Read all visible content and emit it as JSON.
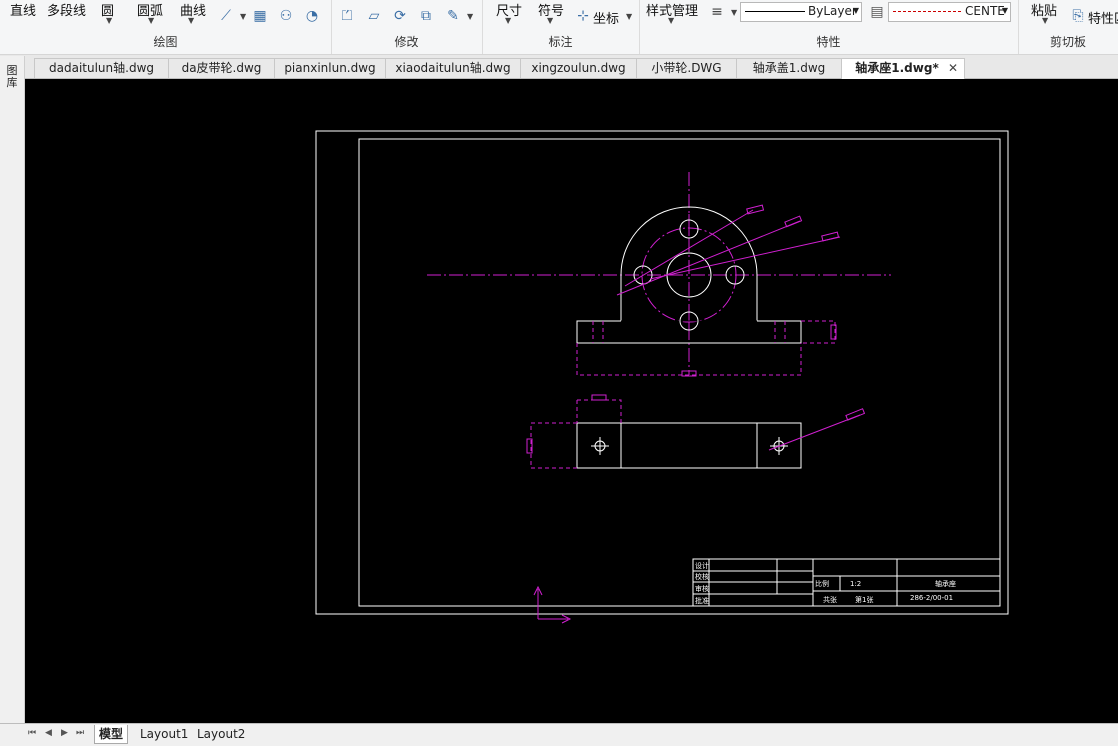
{
  "ribbon": {
    "draw_group": {
      "title": "绘图",
      "line": "直线",
      "polyline": "多段线",
      "circle": "圆",
      "arc": "圆弧",
      "curve": "曲线"
    },
    "modify_group": {
      "title": "修改"
    },
    "annotate_group": {
      "title": "标注",
      "dimension": "尺寸",
      "symbol": "符号",
      "coordinate": "坐标"
    },
    "properties_group": {
      "title": "特性",
      "style_manager": "样式管理",
      "linetype_value": "ByLayer",
      "centerline_value": "CENTE"
    },
    "clipboard_group": {
      "title": "剪切板",
      "paste": "粘贴",
      "properties_short": "特性匹"
    }
  },
  "tabs": [
    {
      "label": "dadaitulun轴.dwg"
    },
    {
      "label": "da皮带轮.dwg"
    },
    {
      "label": "pianxinlun.dwg"
    },
    {
      "label": "xiaodaitulun轴.dwg"
    },
    {
      "label": "xingzoulun.dwg"
    },
    {
      "label": "小带轮.DWG"
    },
    {
      "label": "轴承盖1.dwg"
    },
    {
      "label": "轴承座1.dwg*",
      "active": true
    }
  ],
  "left_strip_label": "图库",
  "layout_tabs": [
    {
      "label": "模型",
      "active": true
    },
    {
      "label": "Layout1"
    },
    {
      "label": "Layout2"
    }
  ],
  "title_block": {
    "rows": [
      "设计",
      "校核",
      "审核",
      "批准"
    ],
    "scale_label": "比例",
    "scale_value": "1:2",
    "part_name": "轴承座",
    "qty_label": "共张",
    "sheet_label": "第1张",
    "drawing_no": "286-2/00-01"
  },
  "colors": {
    "canvas": "#000000",
    "geometry": "#ffffff",
    "center": "#d020d0"
  }
}
